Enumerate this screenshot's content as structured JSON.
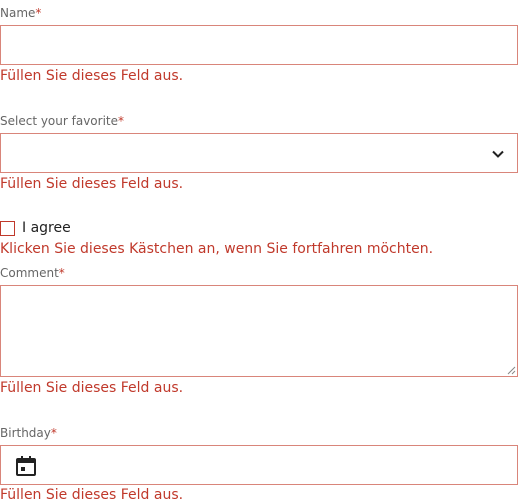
{
  "form": {
    "name": {
      "label": "Name",
      "required_mark": "*",
      "value": "",
      "error": "Füllen Sie dieses Feld aus."
    },
    "favorite": {
      "label": "Select your favorite",
      "required_mark": "*",
      "selected": "",
      "icon": "chevron-down-icon",
      "error": "Füllen Sie dieses Feld aus."
    },
    "agree": {
      "label": "I agree",
      "checked": false,
      "error": "Klicken Sie dieses Kästchen an, wenn Sie fortfahren möchten."
    },
    "comment": {
      "label": "Comment",
      "required_mark": "*",
      "value": "",
      "error": "Füllen Sie dieses Feld aus."
    },
    "birthday": {
      "label": "Birthday",
      "required_mark": "*",
      "value": "",
      "icon": "calendar-icon",
      "error": "Füllen Sie dieses Feld aus."
    }
  },
  "colors": {
    "error": "#c0392b",
    "error_border": "#d9857a",
    "label": "#666666"
  }
}
